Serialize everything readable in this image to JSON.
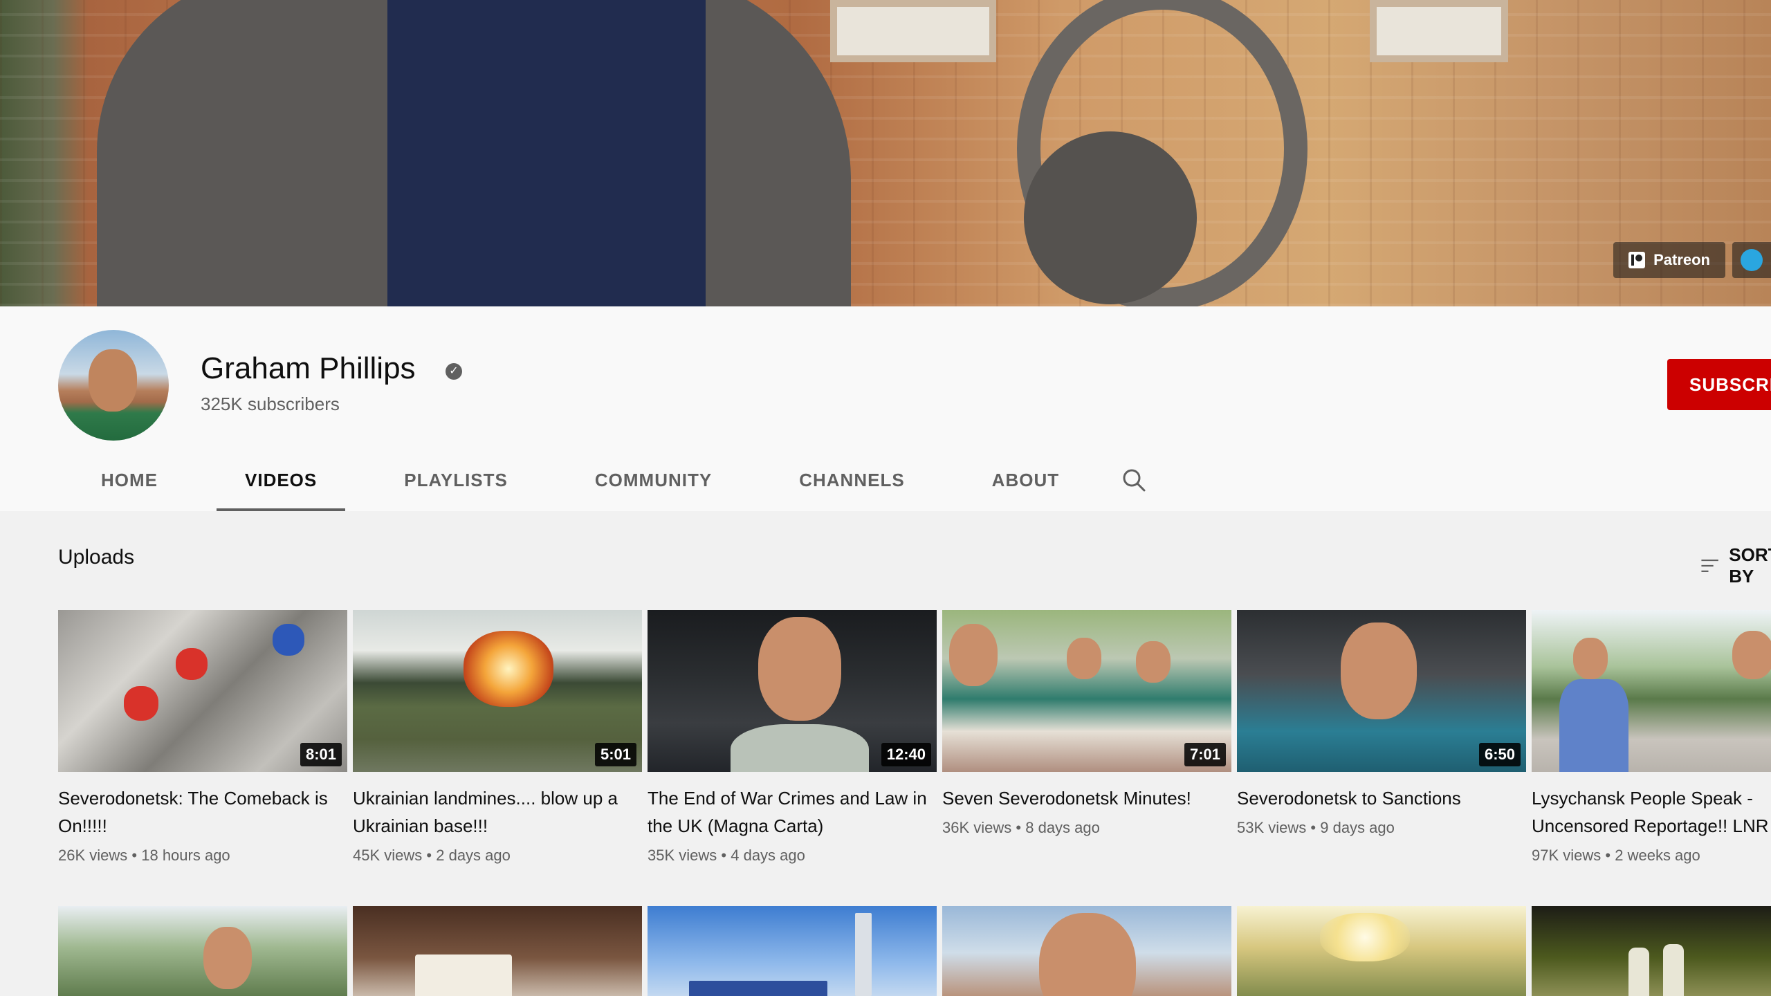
{
  "banner": {
    "links": [
      {
        "label": "Patreon",
        "icon": "patreon-icon"
      },
      {
        "label": "",
        "icon": "telegram-icon"
      }
    ]
  },
  "channel": {
    "name": "Graham Phillips",
    "subscribers": "325K subscribers",
    "subscribe_label": "SUBSCRIBE"
  },
  "tabs": [
    {
      "label": "HOME"
    },
    {
      "label": "VIDEOS"
    },
    {
      "label": "PLAYLISTS"
    },
    {
      "label": "COMMUNITY"
    },
    {
      "label": "CHANNELS"
    },
    {
      "label": "ABOUT"
    }
  ],
  "active_tab": "VIDEOS",
  "section": {
    "title": "Uploads",
    "sort_label": "SORT BY"
  },
  "videos": [
    {
      "title": "Severodonetsk: The Comeback is On!!!!!",
      "duration": "8:01",
      "views": "26K views",
      "age": "18 hours ago"
    },
    {
      "title": "Ukrainian landmines.... blow up a Ukrainian base!!!",
      "duration": "5:01",
      "views": "45K views",
      "age": "2 days ago"
    },
    {
      "title": "The End of War Crimes and Law in the UK (Magna Carta)",
      "duration": "12:40",
      "views": "35K views",
      "age": "4 days ago"
    },
    {
      "title": "Seven Severodonetsk Minutes!",
      "duration": "7:01",
      "views": "36K views",
      "age": "8 days ago"
    },
    {
      "title": "Severodonetsk to Sanctions",
      "duration": "6:50",
      "views": "53K views",
      "age": "9 days ago"
    },
    {
      "title": "Lysychansk People Speak - Uncensored Reportage!! LNR",
      "duration": "",
      "views": "97K views",
      "age": "2 weeks ago"
    }
  ],
  "meta_separator": "•",
  "colors": {
    "subscribe_red": "#cc0000",
    "text_primary": "#0f0f0f",
    "text_secondary": "#606060",
    "page_bg": "#f9f9f9",
    "content_bg": "#f1f1f1"
  }
}
